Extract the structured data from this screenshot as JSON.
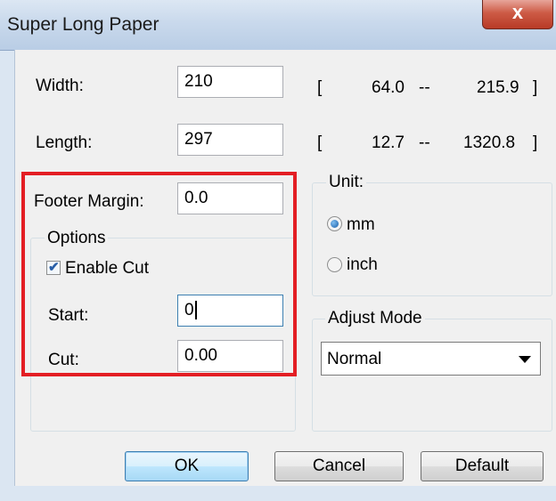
{
  "window": {
    "title": "Super Long Paper",
    "close_glyph": "x"
  },
  "paper": {
    "width_label": "Width:",
    "width_value": "210",
    "width_range_open": "[",
    "width_min": "64.0",
    "width_dash": "--",
    "width_max": "215.9",
    "width_range_close": "]",
    "length_label": "Length:",
    "length_value": "297",
    "length_range_open": "[",
    "length_min": "12.7",
    "length_dash": "--",
    "length_max": "1320.8",
    "length_range_close": "]"
  },
  "footer": {
    "label": "Footer Margin:",
    "value": "0.0"
  },
  "options": {
    "title": "Options",
    "enable_cut_label": "Enable Cut",
    "enable_cut_checked": true,
    "start_label": "Start:",
    "start_value": "0",
    "cut_label": "Cut:",
    "cut_value": "0.00"
  },
  "unit": {
    "title": "Unit:",
    "options": [
      "mm",
      "inch"
    ],
    "selected": "mm"
  },
  "adjust_mode": {
    "title": "Adjust Mode",
    "selected": "Normal"
  },
  "buttons": {
    "ok": "OK",
    "cancel": "Cancel",
    "default": "Default"
  },
  "colors": {
    "highlight": "#e31e24",
    "title_bar": "#c9d9ec",
    "close_button": "#cd5b46"
  }
}
